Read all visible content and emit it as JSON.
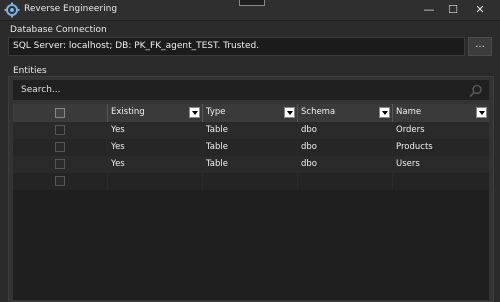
{
  "window": {
    "title": "Reverse Engineering",
    "controls": {
      "minimize": "—",
      "maximize": "☐",
      "close": "✕"
    }
  },
  "connection": {
    "section_label": "Database Connection",
    "value": "SQL Server:  localhost; DB: PK_FK_agent_TEST. Trusted.",
    "browse_label": "..."
  },
  "entities": {
    "section_label": "Entities",
    "search_placeholder": "Search...",
    "columns": [
      "",
      "Existing",
      "Type",
      "Schema",
      "Name"
    ],
    "rows": [
      {
        "existing": "Yes",
        "type": "Table",
        "schema": "dbo",
        "name": "Orders"
      },
      {
        "existing": "Yes",
        "type": "Table",
        "schema": "dbo",
        "name": "Products"
      },
      {
        "existing": "Yes",
        "type": "Table",
        "schema": "dbo",
        "name": "Users"
      }
    ]
  },
  "colors": {
    "background": "#2b2b2b",
    "panel": "#333333",
    "grid": "#1f1f1f",
    "header": "#3a3a3a",
    "text": "#e6e6e6",
    "icon_accent": "#7fb2e5"
  },
  "icons": [
    "settings-gear-icon",
    "search-icon",
    "filter-dropdown-icon"
  ]
}
